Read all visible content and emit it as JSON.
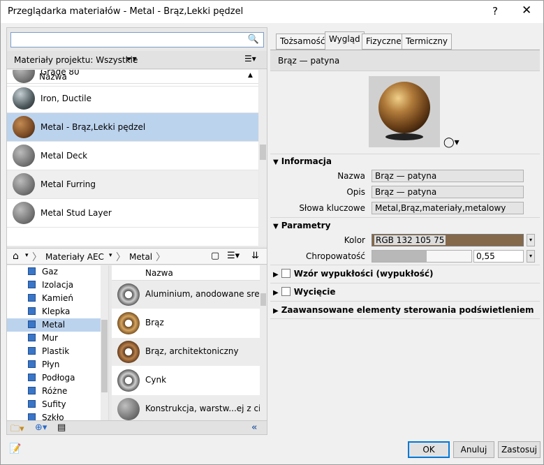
{
  "window": {
    "title": "Przeglądarka materiałów - Metal - Brąz,Lekki pędzel",
    "help": "?",
    "close": "✕"
  },
  "search": {
    "value": "",
    "placeholder": ""
  },
  "project": {
    "label": "Materiały projektu: Wszystkie",
    "column": "Nazwa"
  },
  "project_materials": [
    {
      "name": "Grade 80"
    },
    {
      "name": "Iron, Ductile"
    },
    {
      "name": "Metal - Brąz,Lekki pędzel",
      "selected": true
    },
    {
      "name": "Metal Deck"
    },
    {
      "name": "Metal Furring"
    },
    {
      "name": "Metal Stud Layer"
    }
  ],
  "breadcrumb": {
    "library": "Materiały AEC",
    "category": "Metal"
  },
  "categories": [
    "Gaz",
    "Izolacja",
    "Kamień",
    "Klepka",
    "Metal",
    "Mur",
    "Plastik",
    "Płyn",
    "Podłoga",
    "Różne",
    "Sufity",
    "Szkło"
  ],
  "selected_category": "Metal",
  "library": {
    "column": "Nazwa",
    "items": [
      {
        "name": "Aluminium, anodowane srebrne"
      },
      {
        "name": "Brąz"
      },
      {
        "name": "Brąz, architektoniczny"
      },
      {
        "name": "Cynk"
      },
      {
        "name": "Konstrukcja, warstw...ej z cienk"
      }
    ]
  },
  "tabs": [
    {
      "label": "Tożsamość",
      "active": false
    },
    {
      "label": "Wygląd",
      "active": true
    },
    {
      "label": "Fizyczne",
      "active": false
    },
    {
      "label": "Termiczny",
      "active": false
    }
  ],
  "asset_name": "Brąz — patyna",
  "info": {
    "heading": "Informacja",
    "name_label": "Nazwa",
    "name_value": "Brąz — patyna",
    "desc_label": "Opis",
    "desc_value": "Brąz — patyna",
    "keywords_label": "Słowa kluczowe",
    "keywords_value": "Metal,Brąz,materiały,metalowy"
  },
  "params": {
    "heading": "Parametry",
    "color_label": "Kolor",
    "color_value": "RGB 132 105 75",
    "color_hex": "#84694b",
    "gloss_label": "Chropowatość",
    "gloss_value": "0,55",
    "gloss_fraction": 0.55
  },
  "sections": {
    "bump": "Wzór wypukłości (wypukłość)",
    "cutout": "Wycięcie",
    "advanced": "Zaawansowane elementy sterowania podświetleniem"
  },
  "buttons": {
    "ok": "OK",
    "cancel": "Anuluj",
    "apply": "Zastosuj"
  }
}
